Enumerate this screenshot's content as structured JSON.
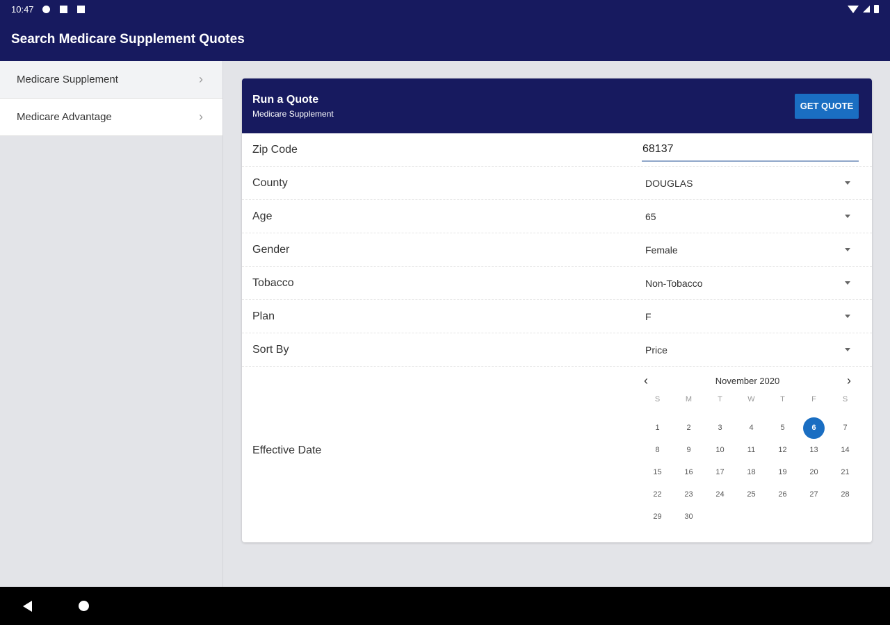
{
  "status": {
    "time": "10:47"
  },
  "app": {
    "title": "Search Medicare Supplement Quotes"
  },
  "sidebar": {
    "items": [
      {
        "label": "Medicare Supplement"
      },
      {
        "label": "Medicare Advantage"
      }
    ]
  },
  "card": {
    "title": "Run a Quote",
    "subtitle": "Medicare Supplement",
    "button": "GET QUOTE"
  },
  "form": {
    "zip": {
      "label": "Zip Code",
      "value": "68137"
    },
    "county": {
      "label": "County",
      "value": "DOUGLAS"
    },
    "age": {
      "label": "Age",
      "value": "65"
    },
    "gender": {
      "label": "Gender",
      "value": "Female"
    },
    "tobacco": {
      "label": "Tobacco",
      "value": "Non-Tobacco"
    },
    "plan": {
      "label": "Plan",
      "value": "F"
    },
    "sort": {
      "label": "Sort By",
      "value": "Price"
    },
    "effective": {
      "label": "Effective Date"
    }
  },
  "calendar": {
    "month": "November 2020",
    "weekdays": [
      "S",
      "M",
      "T",
      "W",
      "T",
      "F",
      "S"
    ],
    "days": [
      "1",
      "2",
      "3",
      "4",
      "5",
      "6",
      "7",
      "8",
      "9",
      "10",
      "11",
      "12",
      "13",
      "14",
      "15",
      "16",
      "17",
      "18",
      "19",
      "20",
      "21",
      "22",
      "23",
      "24",
      "25",
      "26",
      "27",
      "28",
      "29",
      "30"
    ],
    "selected": "6",
    "accent": "#1a6ec2"
  },
  "colors": {
    "primary": "#171a5f",
    "accent": "#1a6ec2"
  }
}
